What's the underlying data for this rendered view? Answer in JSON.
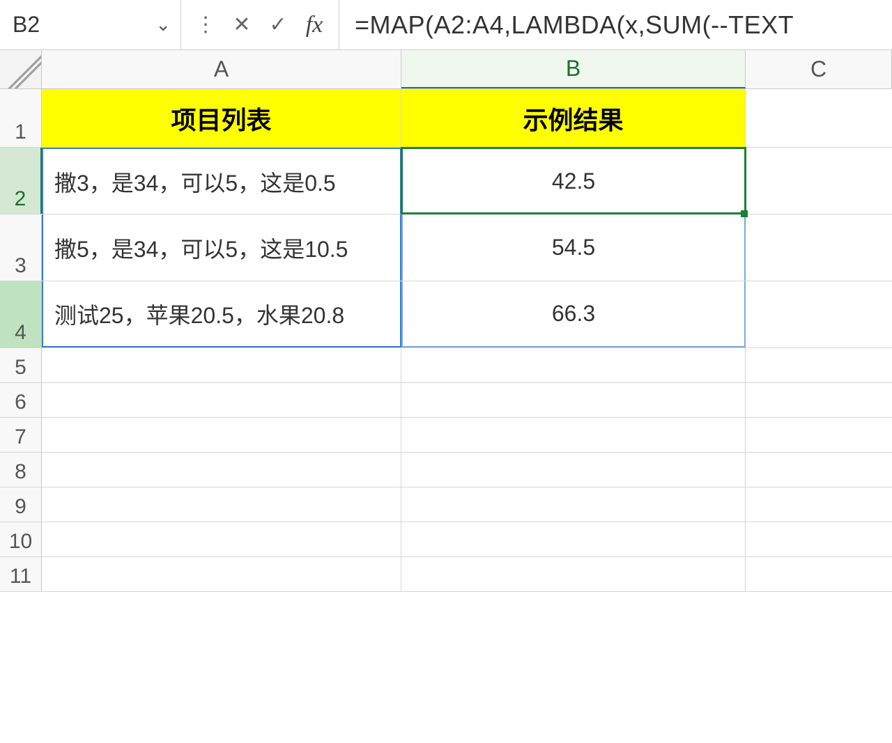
{
  "nameBox": {
    "value": "B2"
  },
  "formulaBar": {
    "value": "=MAP(A2:A4,LAMBDA(x,SUM(--TEXT"
  },
  "columns": {
    "A": "A",
    "B": "B",
    "C": "C"
  },
  "rowLabels": [
    "1",
    "2",
    "3",
    "4",
    "5",
    "6",
    "7",
    "8",
    "9",
    "10",
    "11"
  ],
  "headers": {
    "colA": "项目列表",
    "colB": "示例结果"
  },
  "dataRows": [
    {
      "a": "撒3，是34，可以5，这是0.5",
      "b": "42.5"
    },
    {
      "a": "撒5，是34，可以5，这是10.5",
      "b": "54.5"
    },
    {
      "a": "测试25，苹果20.5，水果20.8",
      "b": "66.3"
    }
  ],
  "icons": {
    "dropdown": "⌄",
    "menu": "⋮",
    "cancel": "✕",
    "confirm": "✓",
    "fx": "fx"
  }
}
